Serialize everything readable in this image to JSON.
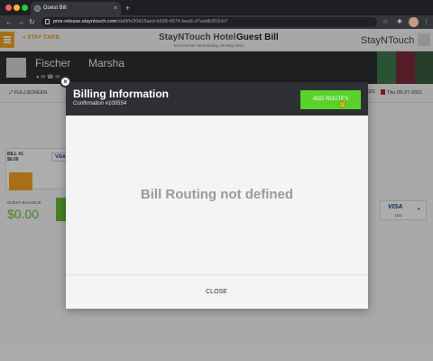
{
  "browser": {
    "tab_title": "Guest Bill",
    "tab_close": "×",
    "new_tab": "+",
    "url_host": "pms-release.stayntouch.com",
    "url_path": "/staff/h/20d15aed-b598-4574-bea6-d7addb303cb7",
    "traffic_lights": [
      "#ff5f57",
      "#febc2e",
      "#28c840"
    ]
  },
  "app": {
    "stay_card_label": "STAY CARD",
    "hotel_name": "StayNTouch Hotel",
    "page_title": "Guest Bill",
    "user_line": "Erin Fischer   Wednesday, 26 May 2021",
    "brand": "StayNTouch",
    "guest_last": "Fischer",
    "guest_first": "Marsha",
    "guest_icons": "●        ✉        ☎        ✉",
    "fullscreen_label": "FULLSCREEN",
    "date_left": "021",
    "date_right": "Thu 05-27-2021",
    "bill_label": "BILL #1",
    "bill_amount": "$0.00",
    "card_brand": "VISA",
    "guest_balance_label": "GUEST BALANCE",
    "guest_balance_value": "$0.00",
    "right_card_number": "1111"
  },
  "modal": {
    "title": "Billing Information",
    "confirmation": "Confirmation #100554",
    "add_routes_label": "ADD ROUTES",
    "empty_message": "Bill Routing not defined",
    "close_label": "CLOSE",
    "dismiss_glyph": "×"
  },
  "colors": {
    "accent_green": "#5bd12c",
    "header_dark": "#2f3033",
    "orange": "#f6a623"
  }
}
